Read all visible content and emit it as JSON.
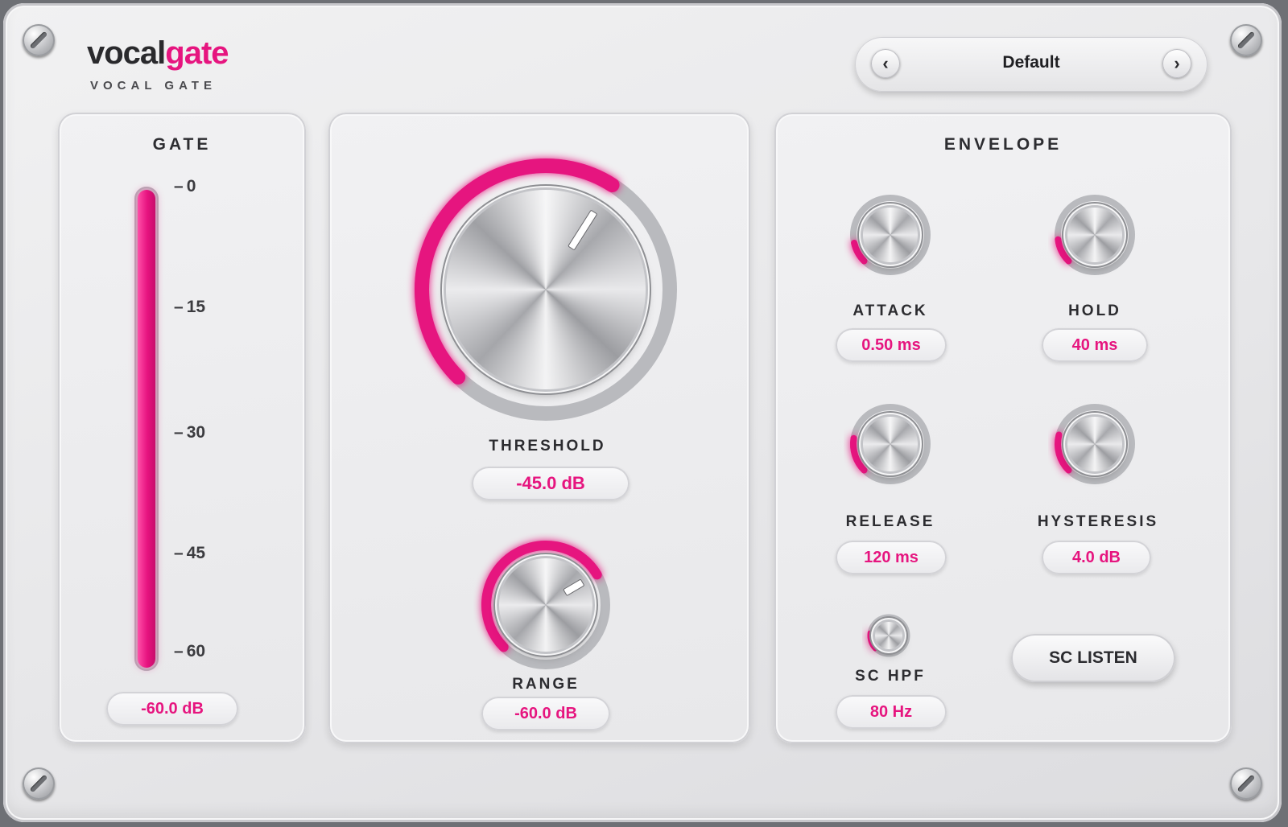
{
  "brand": {
    "name_part1": "vocal",
    "name_part2": "gate",
    "subtitle": "VOCAL GATE"
  },
  "preset": {
    "name": "Default",
    "prev_icon": "chevron-left-icon",
    "next_icon": "chevron-right-icon"
  },
  "colors": {
    "accent": "#e6157f",
    "panel": "#ebebed",
    "text": "#2c2c30",
    "track": "#c9c9cd"
  },
  "gate": {
    "title": "GATE",
    "scale": [
      "0",
      "15",
      "30",
      "45",
      "60"
    ],
    "meter_level_fraction": 1.0,
    "readout": "-60.0 dB"
  },
  "threshold": {
    "label": "THRESHOLD",
    "value": "-45.0 dB",
    "fraction": 0.62
  },
  "range": {
    "label": "RANGE",
    "value": "-60.0 dB",
    "fraction": 0.72
  },
  "envelope": {
    "title": "ENVELOPE",
    "attack": {
      "label": "ATTACK",
      "value": "0.50 ms",
      "fraction": 0.12
    },
    "hold": {
      "label": "HOLD",
      "value": "40 ms",
      "fraction": 0.14
    },
    "release": {
      "label": "RELEASE",
      "value": "120 ms",
      "fraction": 0.2
    },
    "hysteresis": {
      "label": "HYSTERESIS",
      "value": "4.0 dB",
      "fraction": 0.22
    },
    "sc_hpf": {
      "label": "SC HPF",
      "value": "80 Hz",
      "fraction": 0.2
    },
    "sc_listen_label": "SC LISTEN"
  }
}
